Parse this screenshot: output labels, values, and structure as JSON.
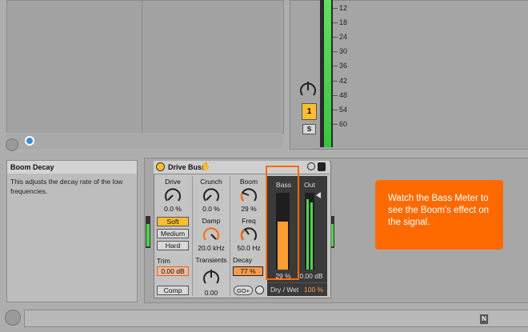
{
  "mixer": {
    "db_labels": [
      "12",
      "18",
      "24",
      "30",
      "36",
      "42",
      "48",
      "54",
      "60"
    ],
    "track_number": "1",
    "solo_label": "S"
  },
  "info": {
    "title": "Boom Decay",
    "text": "This adjusts the decay rate of the low frequencies."
  },
  "device": {
    "name": "Drive Buss",
    "drive": {
      "label": "Drive",
      "value": "0.0 %"
    },
    "crunch": {
      "label": "Crunch",
      "value": "0.0 %"
    },
    "boom": {
      "label": "Boom",
      "value": "29 %"
    },
    "modes": {
      "soft": "Soft",
      "medium": "Medium",
      "hard": "Hard"
    },
    "damp": {
      "label": "Damp",
      "value": "20.0 kHz"
    },
    "freq": {
      "label": "Freq",
      "value": "50.0 Hz"
    },
    "trim": {
      "label": "Trim",
      "value": "0.00 dB"
    },
    "transients": {
      "label": "Transients",
      "value": "0.00"
    },
    "decay": {
      "label": "Decay",
      "value": "77 %"
    },
    "comp_label": "Comp",
    "goplus_label": "GO+",
    "bass": {
      "label": "Bass",
      "value": "29 %",
      "level": 0.62
    },
    "out": {
      "label": "Out",
      "value": "0.00 dB"
    },
    "drywet": {
      "label": "Dry / Wet",
      "value": "100 %"
    }
  },
  "callout": {
    "text": "Watch the Bass Meter to see the Boom's effect on the signal."
  },
  "colors": {
    "accent_orange": "#ff6a00",
    "active_yellow": "#ffbe2e",
    "meter_green": "#4fd24f"
  }
}
